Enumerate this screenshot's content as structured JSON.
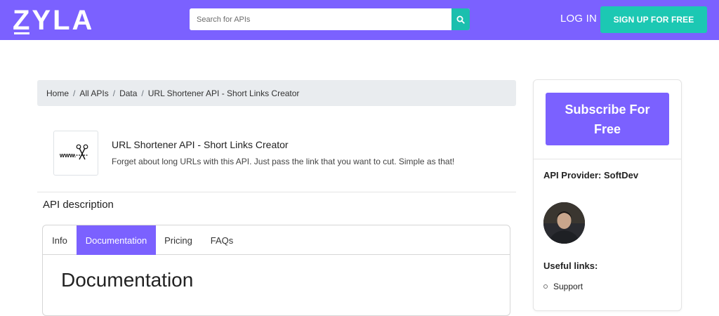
{
  "header": {
    "logo_text": "ZYLA",
    "search_placeholder": "Search for APIs",
    "login_label": "LOG IN",
    "signup_label": "SIGN UP FOR FREE",
    "brand_color": "#7b61ff",
    "accent_color": "#1cc8b3"
  },
  "breadcrumb": [
    "Home",
    "All APIs",
    "Data",
    "URL Shortener API - Short Links Creator"
  ],
  "api": {
    "logo_text": "www.",
    "title": "URL Shortener API - Short Links Creator",
    "subtitle": "Forget about long URLs with this API. Just pass the link that you want to cut. Simple as that!",
    "description_heading": "API description"
  },
  "tabs": [
    {
      "label": "Info",
      "active": false
    },
    {
      "label": "Documentation",
      "active": true
    },
    {
      "label": "Pricing",
      "active": false
    },
    {
      "label": "FAQs",
      "active": false
    }
  ],
  "documentation_heading": "Documentation",
  "sidebar": {
    "subscribe_label": "Subscribe For Free",
    "provider_label": "API Provider: SoftDev",
    "useful_links_heading": "Useful links:",
    "links": [
      "Support"
    ]
  }
}
